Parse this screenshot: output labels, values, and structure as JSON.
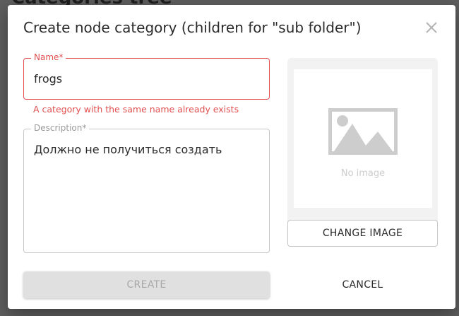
{
  "background": {
    "title": "Categories tree"
  },
  "dialog": {
    "title": "Create node category (children for \"sub folder\")",
    "close_icon": "close-icon"
  },
  "name_field": {
    "label": "Name*",
    "value": "frogs",
    "error": "A category with the same name already exists",
    "state": "error"
  },
  "description_field": {
    "label": "Description*",
    "value": "Должно не получиться создать"
  },
  "image": {
    "placeholder_icon": "image-placeholder-icon",
    "no_image_text": "No image",
    "change_label": "CHANGE IMAGE"
  },
  "actions": {
    "create_label": "CREATE",
    "create_enabled": false,
    "cancel_label": "CANCEL"
  },
  "colors": {
    "error": "#e25050",
    "border": "#c6c6c6",
    "disabled_bg": "#e0e0e0",
    "disabled_text": "#a8a8a8",
    "overlay": "#5e5e5e"
  }
}
